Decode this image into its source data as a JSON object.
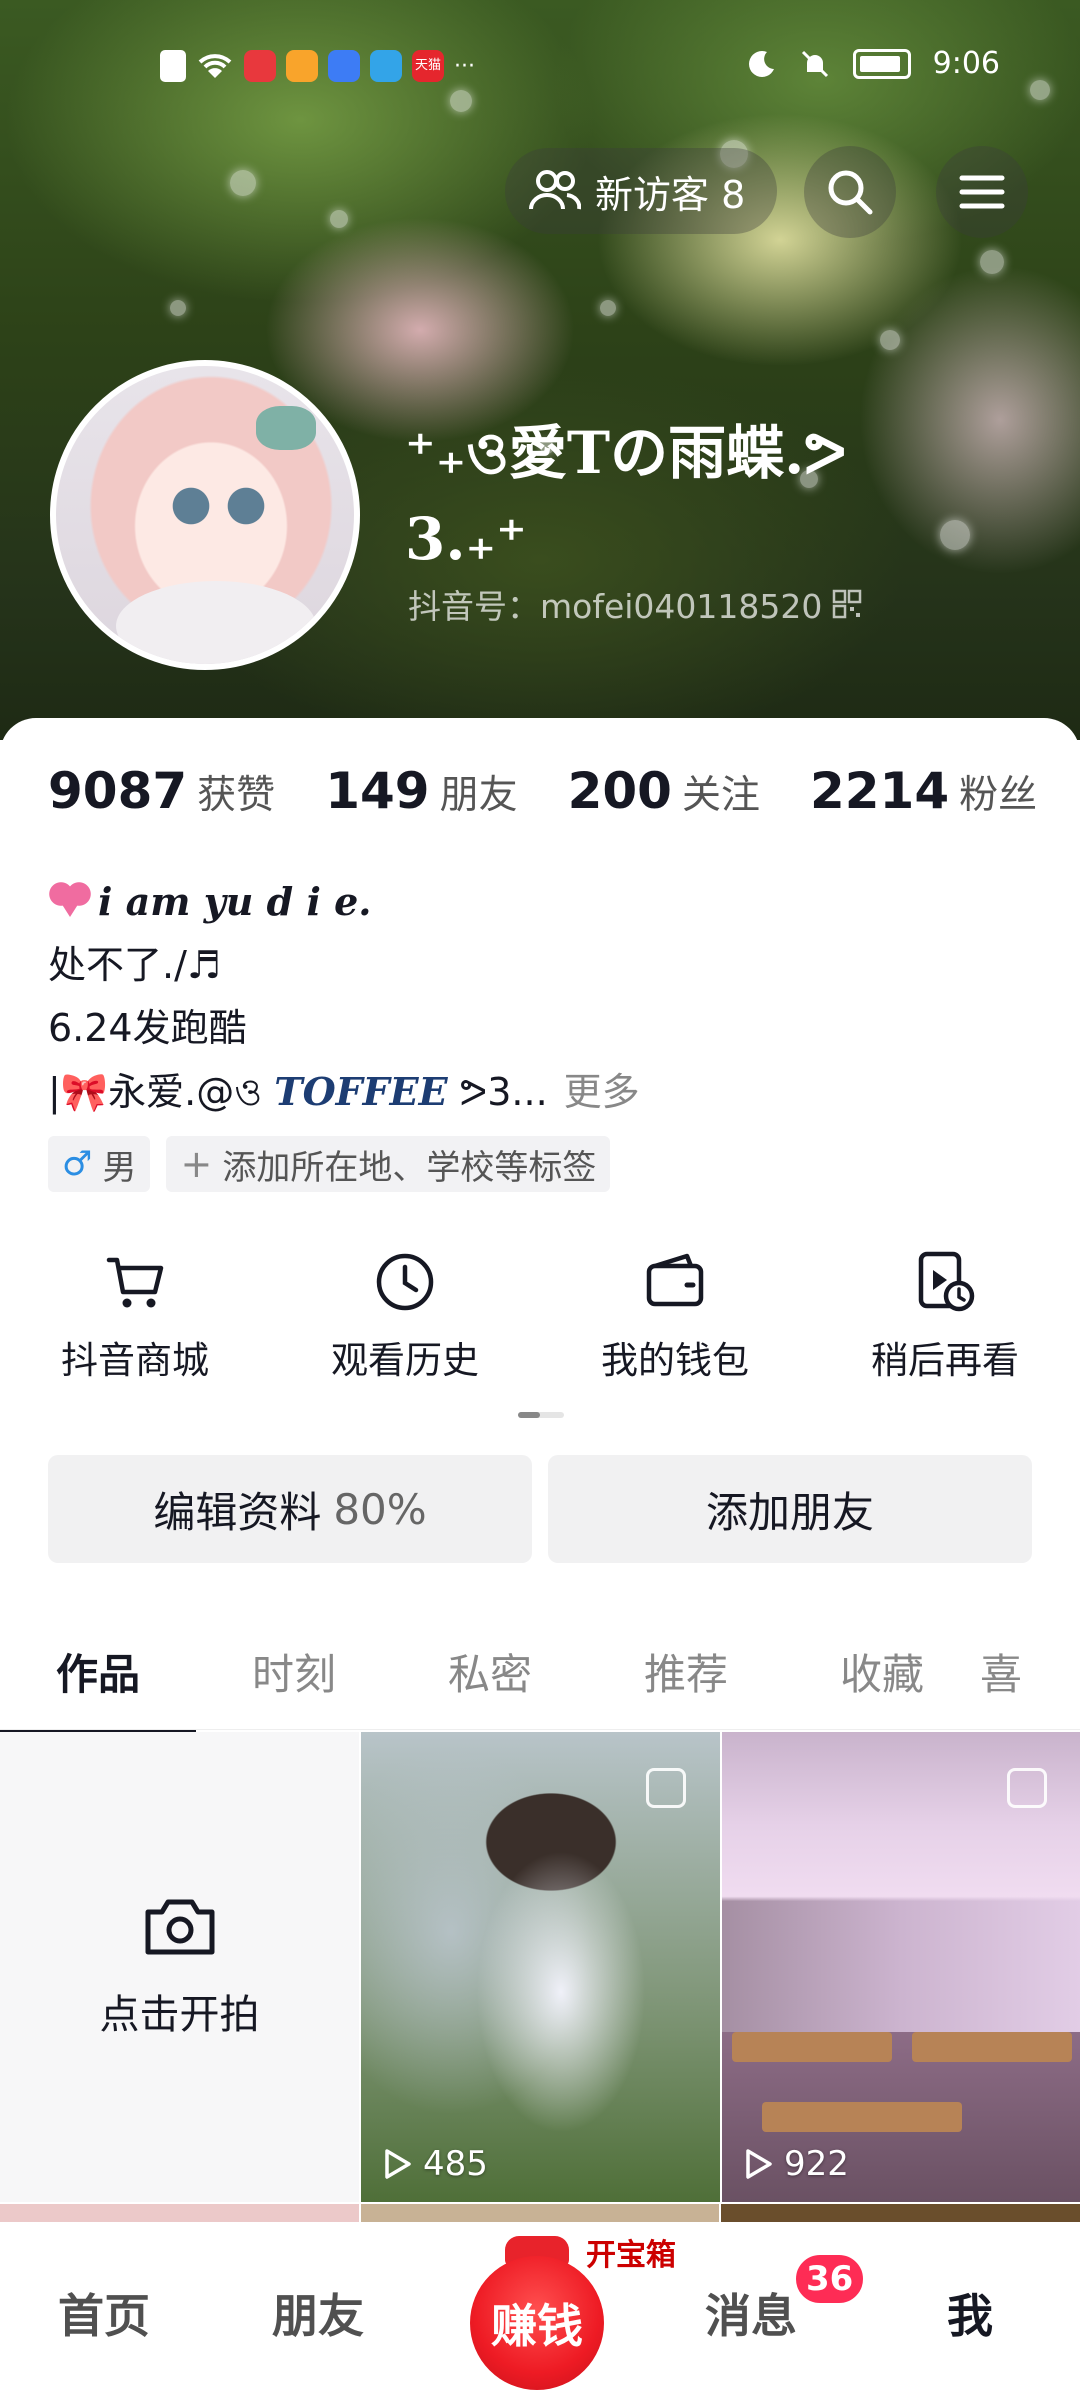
{
  "status_bar": {
    "time": "9:06",
    "more_indicator": "···",
    "app_icons": [
      "alert-icon",
      "wifi-icon",
      "book-app-icon",
      "video-app-icon",
      "music-app-icon",
      "game-app-icon",
      "tmall-app-icon"
    ],
    "tmall_label": "天猫"
  },
  "header": {
    "visitor_label": "新访客 8",
    "search_icon": "search-icon",
    "menu_icon": "menu-icon"
  },
  "profile": {
    "nickname": "⁺₊ও愛Tの雨蝶.ᕗ 3.₊⁺",
    "douyin_id": "抖音号：mofei040118520"
  },
  "stats": [
    {
      "value": "9087",
      "label": "获赞"
    },
    {
      "value": "149",
      "label": "朋友"
    },
    {
      "value": "200",
      "label": "关注"
    },
    {
      "value": "2214",
      "label": "粉丝"
    }
  ],
  "bio": {
    "line1": "i am yu d i e.",
    "line2": "处不了./♬",
    "line3": "6.24发跑酷",
    "line4_prefix": "|",
    "line4_text": "永爱.@ও",
    "line4_toffee": "TOFFEE",
    "line4_suffix": "ᕗ3...",
    "more": "更多"
  },
  "tags": {
    "gender_symbol": "♂",
    "gender": "男",
    "add_tag": "添加所在地、学校等标签"
  },
  "tools": [
    {
      "label": "抖音商城",
      "icon": "cart-icon"
    },
    {
      "label": "观看历史",
      "icon": "clock-icon"
    },
    {
      "label": "我的钱包",
      "icon": "wallet-icon"
    },
    {
      "label": "稍后再看",
      "icon": "watch-later-icon"
    }
  ],
  "actions": {
    "edit_profile": "编辑资料",
    "edit_percent": "80%",
    "add_friends": "添加朋友"
  },
  "tabs": [
    "作品",
    "时刻",
    "私密",
    "推荐",
    "收藏",
    "喜"
  ],
  "grid": {
    "shoot_label": "点击开拍",
    "videos": [
      {
        "plays": "485"
      },
      {
        "plays": "922"
      }
    ]
  },
  "bottom_nav": {
    "home": "首页",
    "friends": "朋友",
    "earn": "赚钱",
    "chest": "开宝箱",
    "messages": "消息",
    "messages_badge": "36",
    "me": "我"
  }
}
